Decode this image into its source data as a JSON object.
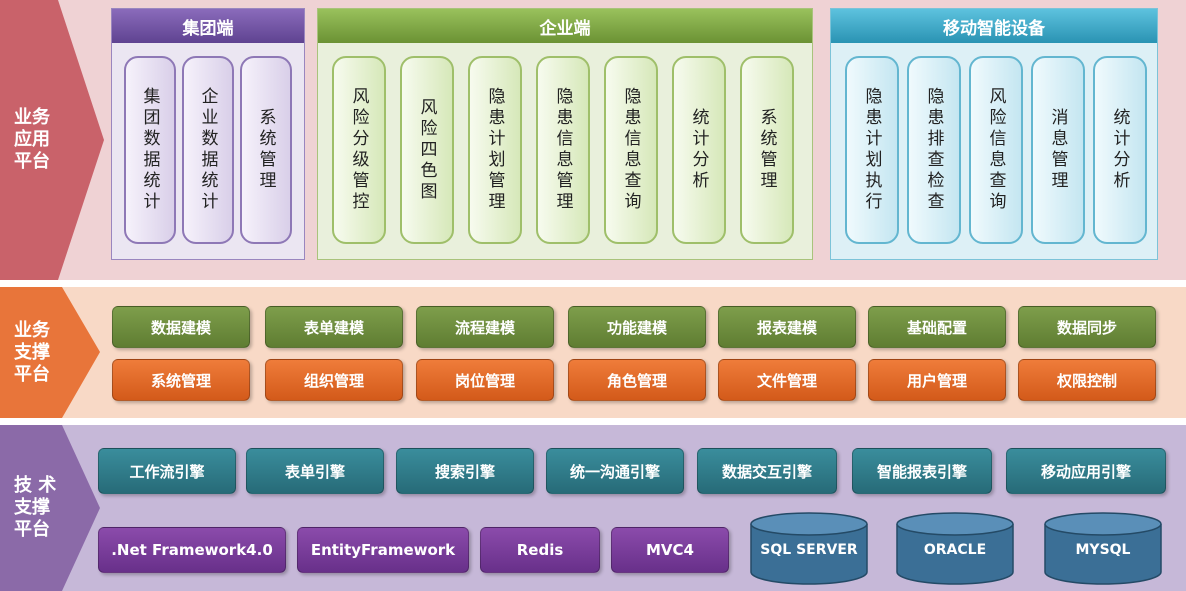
{
  "bands": {
    "app": {
      "label": "业务\n应用\n平台",
      "sections": {
        "group": {
          "title": "集团端",
          "cards": [
            "集团数据统计",
            "企业数据统计",
            "系统管理"
          ]
        },
        "enterprise": {
          "title": "企业端",
          "cards": [
            "风险分级管控",
            "风险四色图",
            "隐患计划管理",
            "隐患信息管理",
            "隐患信息查询",
            "统计分析",
            "系统管理"
          ]
        },
        "mobile": {
          "title": "移动智能设备",
          "cards": [
            "隐患计划执行",
            "隐患排查检查",
            "风险信息查询",
            "消息管理",
            "统计分析"
          ]
        }
      }
    },
    "support": {
      "label": "业务\n支撑\n平台",
      "row1": [
        "数据建模",
        "表单建模",
        "流程建模",
        "功能建模",
        "报表建模",
        "基础配置",
        "数据同步"
      ],
      "row2": [
        "系统管理",
        "组织管理",
        "岗位管理",
        "角色管理",
        "文件管理",
        "用户管理",
        "权限控制"
      ]
    },
    "tech": {
      "label": "技 术\n支撑\n平台",
      "engines": [
        "工作流引擎",
        "表单引擎",
        "搜索引擎",
        "统一沟通引擎",
        "数据交互引擎",
        "智能报表引擎",
        "移动应用引擎"
      ],
      "frameworks": [
        ".Net Framework4.0",
        "EntityFramework",
        "Redis",
        "MVC4"
      ],
      "databases": [
        "SQL SERVER",
        "ORACLE",
        "MYSQL"
      ]
    }
  },
  "colors": {
    "app_band": "#efd2d4",
    "app_arrow": "#c9626a",
    "support_band": "#f8d9c6",
    "support_arrow": "#e8753a",
    "tech_band": "#c6b8d8",
    "tech_arrow": "#8b6aa8",
    "group_header": "#7354a3",
    "enterprise_header": "#7fa945",
    "mobile_header": "#3aa9c9",
    "green_pill": "#6f8f3f",
    "orange_pill": "#e06a27",
    "teal_pill": "#2f7b8a",
    "purple_pill": "#7a3d9a",
    "db_blue": "#3b6f96"
  }
}
